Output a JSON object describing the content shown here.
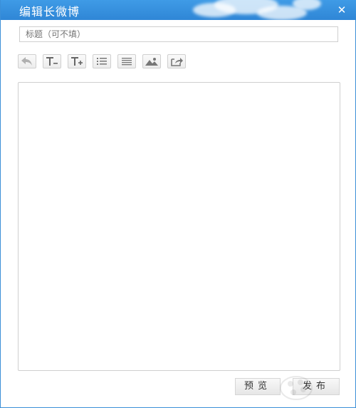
{
  "window": {
    "title": "编辑长微博",
    "close_glyph": "✕",
    "colors": {
      "titlebar": "#3b8fd8",
      "border": "#cfcfcf"
    }
  },
  "title_field": {
    "value": "",
    "placeholder": "标题（可不填）"
  },
  "toolbar": {
    "buttons": [
      {
        "icon": "undo-icon",
        "name": "undo-button"
      },
      {
        "icon": "font-smaller-icon",
        "name": "font-smaller-button"
      },
      {
        "icon": "font-larger-icon",
        "name": "font-larger-button"
      },
      {
        "icon": "list-icon",
        "name": "list-button"
      },
      {
        "icon": "align-icon",
        "name": "align-button"
      },
      {
        "icon": "image-icon",
        "name": "insert-image-button"
      },
      {
        "icon": "share-icon",
        "name": "share-button"
      }
    ]
  },
  "editor": {
    "content": ""
  },
  "footer": {
    "preview_label": "预览",
    "publish_label": "发布"
  }
}
